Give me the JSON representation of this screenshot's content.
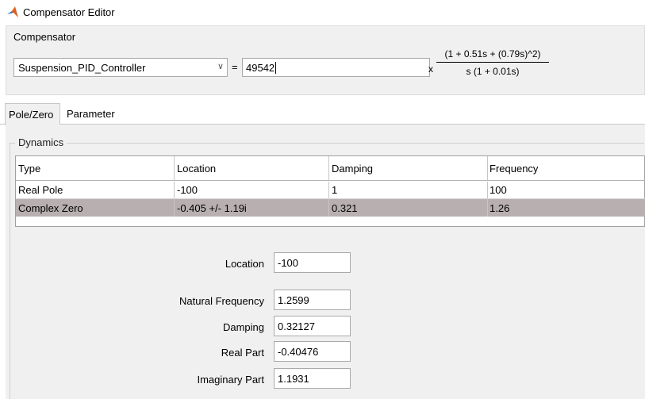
{
  "window": {
    "title": "Compensator Editor"
  },
  "compensator": {
    "label": "Compensator",
    "selected": "Suspension_PID_Controller",
    "equals": "=",
    "gain": "49542",
    "times": "x",
    "numerator": "(1 + 0.51s + (0.79s)^2)",
    "denominator": "s (1 + 0.01s)"
  },
  "tabs": [
    {
      "label": "Pole/Zero"
    },
    {
      "label": "Parameter"
    }
  ],
  "dynamics": {
    "label": "Dynamics",
    "columns": [
      "Type",
      "Location",
      "Damping",
      "Frequency"
    ],
    "rows": [
      [
        "Real Pole",
        "-100",
        "1",
        "100"
      ],
      [
        "Complex Zero",
        "-0.405 +/- 1.19i",
        "0.321",
        "1.26"
      ]
    ]
  },
  "fields": {
    "location": {
      "label": "Location",
      "value": "-100"
    },
    "natural_frequency": {
      "label": "Natural Frequency",
      "value": "1.2599"
    },
    "damping": {
      "label": "Damping",
      "value": "0.32127"
    },
    "real_part": {
      "label": "Real Part",
      "value": "-0.40476"
    },
    "imaginary_part": {
      "label": "Imaginary Part",
      "value": "1.1931"
    }
  }
}
